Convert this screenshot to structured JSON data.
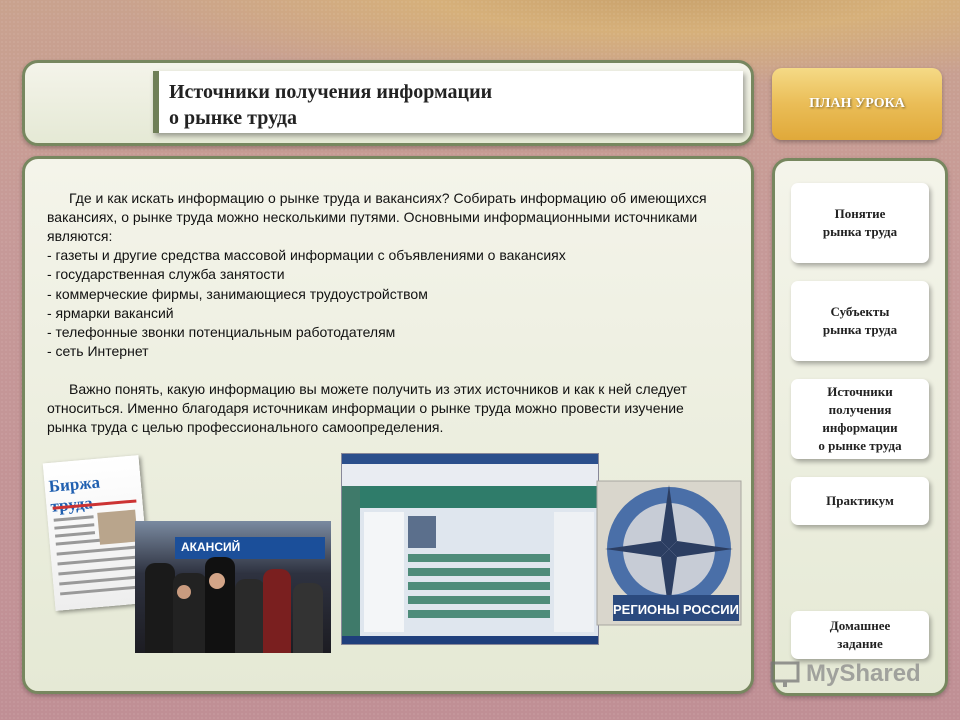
{
  "title": "Источники получения информации\nо рынке труда",
  "plan_label": "ПЛАН УРОКА",
  "intro": "Где и как искать информацию о рынке труда и вакансиях? Собирать информацию об имеющихся вакансиях, о рынке труда можно несколькими путями. Основными информационными источниками являются:",
  "sources": [
    "-  газеты и другие средства массовой информации с объявлениями о вакансиях",
    "-  государственная служба занятости",
    "-  коммерческие фирмы, занимающиеся трудоустройством",
    "-  ярмарки вакансий",
    "-  телефонные звонки потенциальным работодателям",
    "-  сеть Интернет"
  ],
  "conclusion": "Важно понять, какую информацию вы можете получить из этих источников и как к ней следует относиться.  Именно благодаря источникам информации о рынке труда можно провести изучение рынка труда с целью профессионального самоопределения.",
  "nav": [
    "Понятие\nрынка труда",
    "Субъекты\nрынка труда",
    "Источники\nполучения\nинформации\nо рынке труда",
    "Практикум",
    "Домашнее\nзадание"
  ],
  "images": {
    "newspaper_title": "Биржа труда",
    "banner_text": "АКАНСИЙ",
    "disc_caption": "РЕГИОНЫ РОССИИ"
  },
  "watermark": "MyShared"
}
